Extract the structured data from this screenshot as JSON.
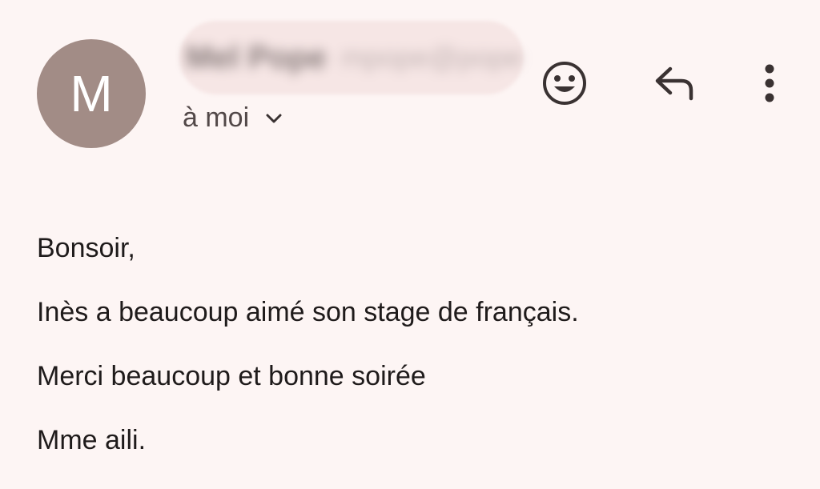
{
  "header": {
    "avatar_letter": "M",
    "sender_name_redacted": "Mel Pope",
    "sender_email_redacted": "mpope@pope",
    "recipient_label": "à moi",
    "icons": {
      "emoji": "smiley-reaction-icon",
      "reply": "reply-arrow-icon",
      "more": "more-vertical-icon",
      "expand": "chevron-down-icon"
    }
  },
  "body": {
    "lines": [
      "Bonsoir,",
      "Inès a beaucoup aimé son stage de français.",
      "Merci beaucoup et bonne soirée",
      "Mme aili."
    ]
  },
  "colors": {
    "background": "#fdf5f4",
    "avatar_bg": "#a28c86",
    "icon": "#3a3232",
    "text": "#1f1b1b"
  }
}
